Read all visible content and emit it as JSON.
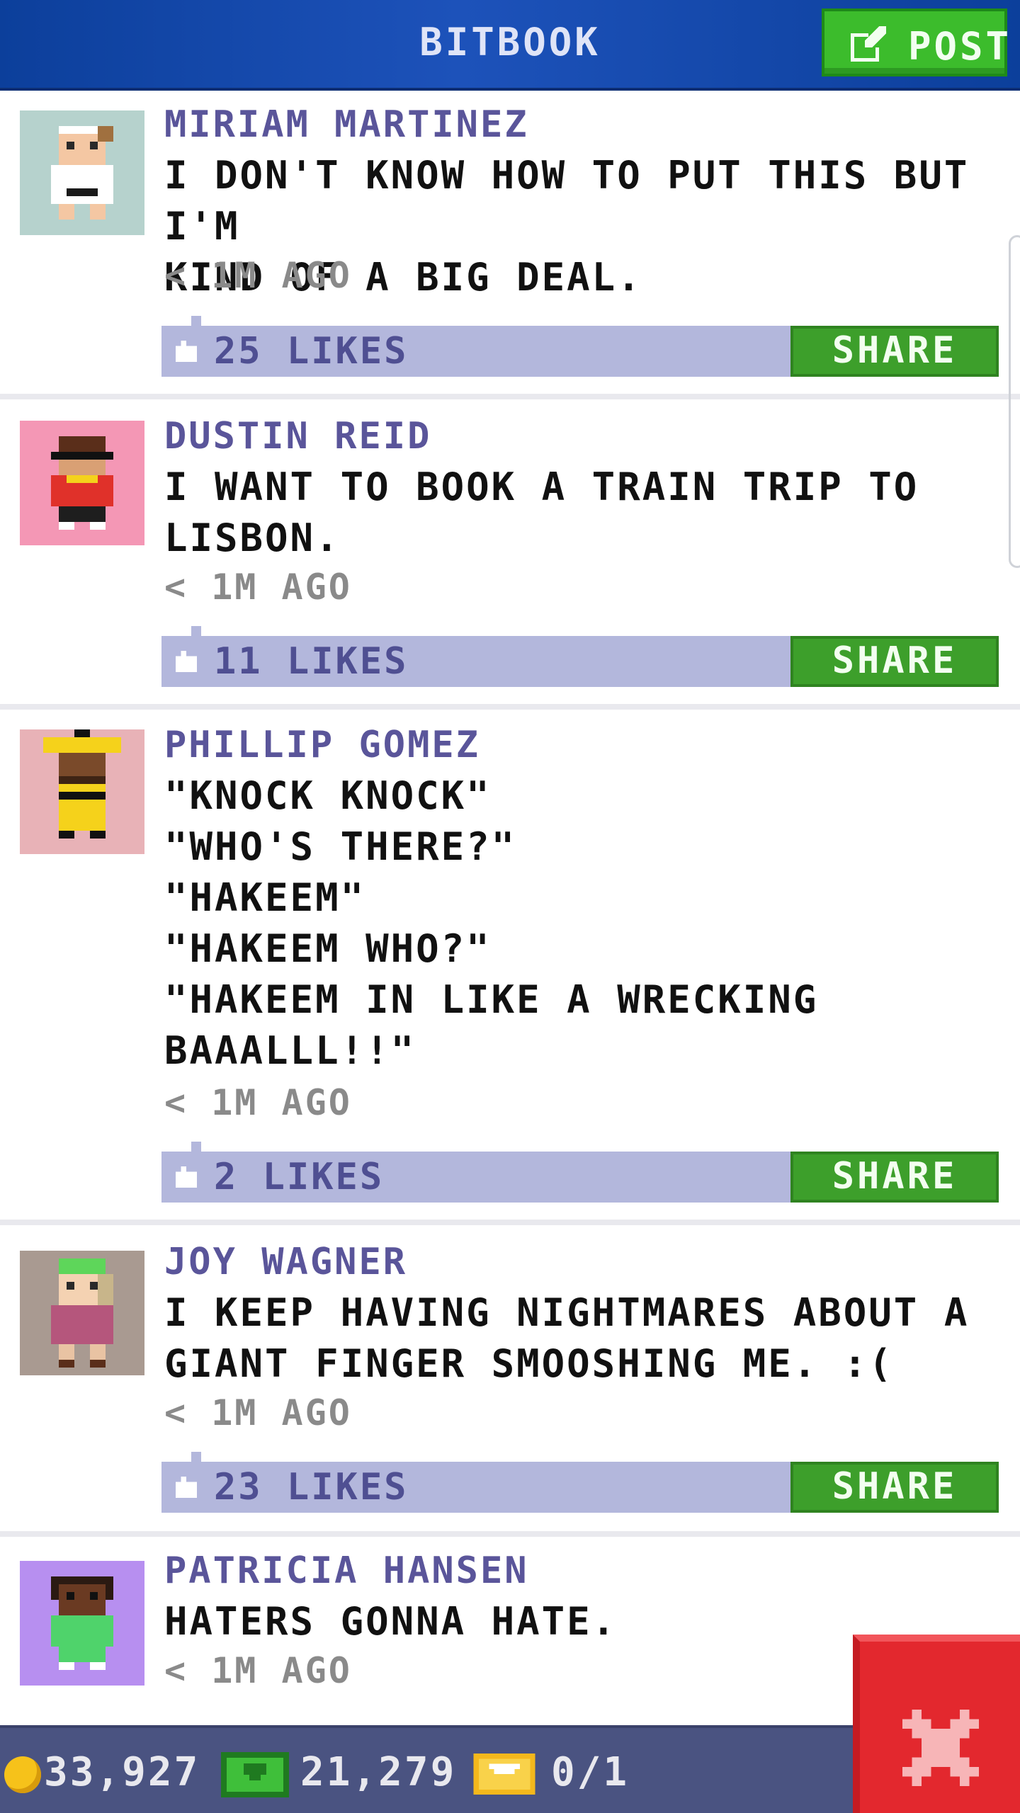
{
  "header": {
    "title": "BITBOOK",
    "post_button": "POST"
  },
  "posts": [
    {
      "author": "MIRIAM MARTINEZ",
      "text": "I DON'T KNOW HOW TO PUT THIS BUT I'M\nKIND OF A BIG DEAL.",
      "time": "< 1M AGO",
      "likes": "25 LIKES",
      "share": "SHARE",
      "avatar_bg": "#b6d2cd"
    },
    {
      "author": "DUSTIN REID",
      "text": "I WANT TO BOOK A TRAIN TRIP TO\nLISBON.",
      "time": "< 1M AGO",
      "likes": "11 LIKES",
      "share": "SHARE",
      "avatar_bg": "#f497b5"
    },
    {
      "author": "PHILLIP GOMEZ",
      "text": "\"KNOCK KNOCK\"\n\"WHO'S THERE?\"\n\"HAKEEM\"\n\"HAKEEM WHO?\"\n\"HAKEEM IN LIKE A WRECKING\nBAAALLL!!\"",
      "time": "< 1M AGO",
      "likes": "2 LIKES",
      "share": "SHARE",
      "avatar_bg": "#e8b2b7"
    },
    {
      "author": "JOY WAGNER",
      "text": "I KEEP HAVING NIGHTMARES ABOUT A\nGIANT FINGER SMOOSHING ME. :(",
      "time": "< 1M AGO",
      "likes": "23 LIKES",
      "share": "SHARE",
      "avatar_bg": "#a99a91"
    },
    {
      "author": "PATRICIA HANSEN",
      "text": "HATERS GONNA HATE.",
      "time": "< 1M AGO",
      "avatar_bg": "#b78ff0"
    }
  ],
  "status_bar": {
    "coins": "33,927",
    "bux": "21,279",
    "tickets": "0/1"
  },
  "icons": {
    "post": "edit-icon",
    "like": "thumbs-up-icon",
    "coin": "coin-icon",
    "bux": "cash-icon",
    "ticket": "ticket-icon",
    "close": "close-icon"
  },
  "colors": {
    "header": "#1d52ba",
    "accent_green": "#3d9f2b",
    "likes_bar": "#b3b7dc",
    "author": "#5a559a",
    "close": "#e3282e"
  }
}
